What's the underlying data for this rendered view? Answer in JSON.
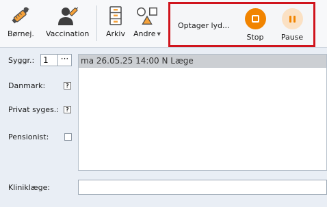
{
  "toolbar": {
    "items": [
      {
        "label": "Børnej.",
        "icon": "syringe-child-icon"
      },
      {
        "label": "Vaccination",
        "icon": "vaccination-user-icon"
      },
      {
        "label": "Arkiv",
        "icon": "archive-icon"
      },
      {
        "label": "Andre",
        "icon": "shapes-icon"
      }
    ],
    "recording": {
      "status": "Optager lyd...",
      "stop_label": "Stop",
      "pause_label": "Pause",
      "accent": "#f18400",
      "highlight": "#d0141d"
    }
  },
  "form": {
    "sygrp_label": "Syggr.:",
    "sygrp_value": "1",
    "dots": "···",
    "danmark_label": "Danmark:",
    "privat_label": "Privat syges.:",
    "pensionist_label": "Pensionist:",
    "help_mark": "?",
    "note_header": "ma 26.05.25  14:00 N Læge",
    "klinik_label": "Kliniklæge:",
    "klinik_value": ""
  }
}
